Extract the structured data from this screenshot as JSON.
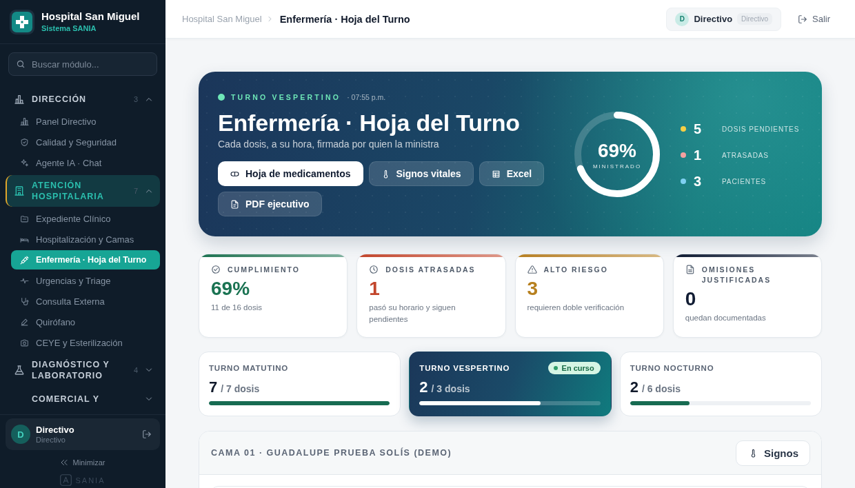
{
  "sidebar": {
    "brand": {
      "title": "Hospital San Miguel",
      "subtitle": "Sistema SANIA"
    },
    "search": {
      "placeholder": "Buscar módulo..."
    },
    "groups": [
      {
        "label": "DIRECCIÓN",
        "count": "3",
        "expanded": true,
        "selected": false,
        "items": [
          {
            "label": "Panel Directivo",
            "selected": false
          },
          {
            "label": "Calidad y Seguridad",
            "selected": false
          },
          {
            "label": "Agente IA · Chat",
            "selected": false
          }
        ]
      },
      {
        "label": "ATENCIÓN HOSPITALARIA",
        "count": "7",
        "expanded": true,
        "selected": true,
        "items": [
          {
            "label": "Expediente Clínico",
            "selected": false
          },
          {
            "label": "Hospitalización y Camas",
            "selected": false
          },
          {
            "label": "Enfermería · Hoja del Turno",
            "selected": true
          },
          {
            "label": "Urgencias y Triage",
            "selected": false
          },
          {
            "label": "Consulta Externa",
            "selected": false
          },
          {
            "label": "Quirófano",
            "selected": false
          },
          {
            "label": "CEYE y Esterilización",
            "selected": false
          }
        ]
      },
      {
        "label": "DIAGNÓSTICO Y LABORATORIO",
        "count": "4",
        "expanded": false,
        "selected": false
      },
      {
        "label": "COMERCIAL Y",
        "expanded": false,
        "selected": false
      }
    ],
    "user": {
      "initial": "D",
      "name": "Directivo",
      "role": "Directivo"
    },
    "minimize": "Minimizar",
    "wordmark": "SANIA"
  },
  "topbar": {
    "breadcrumb": [
      "Hospital San Miguel",
      "Enfermería · Hoja del Turno"
    ],
    "user": {
      "initial": "D",
      "name": "Directivo",
      "role": "Directivo"
    },
    "logout": "Salir"
  },
  "hero": {
    "shift": "TURNO VESPERTINO",
    "time": "· 07:55 p.m.",
    "title": "Enfermería · Hoja del Turno",
    "subtitle": "Cada dosis, a su hora, firmada por quien la ministra",
    "buttons": [
      {
        "label": "Hoja de medicamentos",
        "kind": "primary"
      },
      {
        "label": "Signos vitales",
        "kind": "secondary"
      },
      {
        "label": "Excel",
        "kind": "secondary"
      },
      {
        "label": "PDF ejecutivo",
        "kind": "secondary"
      }
    ],
    "progress": {
      "value": "69%",
      "label": "MINISTRADO",
      "level": 0.69
    },
    "stats": [
      {
        "value": "5",
        "label": "DOSIS PENDIENTES",
        "color": "#f5cf45"
      },
      {
        "value": "1",
        "label": "ATRASADAS",
        "color": "#f4a0a0"
      },
      {
        "value": "3",
        "label": "PACIENTES",
        "color": "#7fd0f2"
      }
    ]
  },
  "kpis": [
    {
      "label": "CUMPLIMIENTO",
      "value": "69%",
      "description": "11 de 16 dosis",
      "color": "#1a7352"
    },
    {
      "label": "DOSIS ATRASADAS",
      "value": "1",
      "description": "pasó su horario y siguen pendientes",
      "color": "#c2452b"
    },
    {
      "label": "ALTO RIESGO",
      "value": "3",
      "description": "requieren doble verificación",
      "color": "#b7801f"
    },
    {
      "label": "OMISIONES JUSTIFICADAS",
      "value": "0",
      "description": "quedan documentadas",
      "color": "#111c33"
    }
  ],
  "shifts": [
    {
      "label": "TURNO MATUTINO",
      "value": "7",
      "total": "/ 7 dosis",
      "level": 1.0,
      "selected": false
    },
    {
      "label": "TURNO VESPERTINO",
      "value": "2",
      "total": "/ 3 dosis",
      "level": 0.67,
      "selected": true,
      "badge": "En curso"
    },
    {
      "label": "TURNO NOCTURNO",
      "value": "2",
      "total": "/ 6 dosis",
      "level": 0.33,
      "selected": false
    }
  ],
  "bed_panel": {
    "title": "CAMA 01 · GUADALUPE PRUEBA SOLÍS (DEMO)",
    "button": "Signos"
  }
}
